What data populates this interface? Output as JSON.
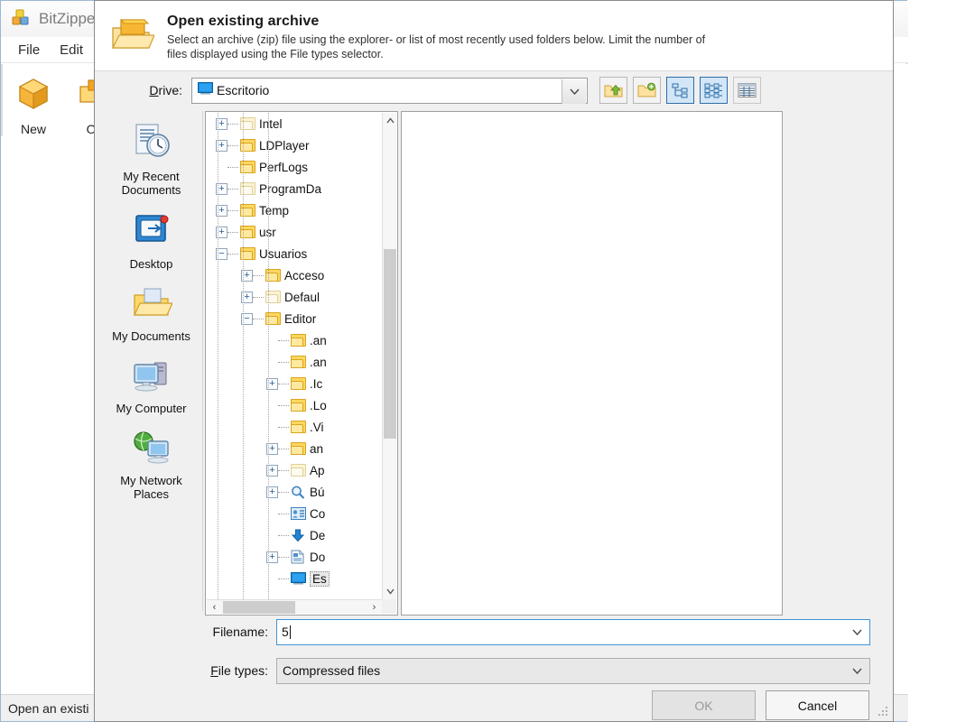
{
  "background_window": {
    "title": "BitZipper",
    "menus": [
      "File",
      "Edit"
    ],
    "toolbar_buttons": [
      {
        "label": "New",
        "icon": "new-archive-icon"
      },
      {
        "label": "Op",
        "icon": "open-archive-icon"
      }
    ],
    "window_controls": {
      "restore": "❐",
      "close": "✕"
    },
    "status_text": "Open an existi"
  },
  "dialog": {
    "icon": "open-folder-archive-icon",
    "title": "Open existing archive",
    "subtitle": "Select an archive (zip) file using the explorer- or list of most recently used folders below. Limit the number of files displayed using the File types selector.",
    "drive": {
      "label": "Drive:",
      "label_accel": "D",
      "value": "Escritorio",
      "icon": "monitor-icon",
      "arrow": "⌄"
    },
    "toolbar": [
      {
        "name": "up-one-level-button",
        "icon": "folder-up-arrow-icon",
        "selected": false
      },
      {
        "name": "create-new-folder-button",
        "icon": "folder-new-icon",
        "selected": false
      },
      {
        "name": "tree-view-button",
        "icon": "tree-view-icon",
        "selected": true
      },
      {
        "name": "list-view-button",
        "icon": "list-view-icon",
        "selected": true
      },
      {
        "name": "details-view-button",
        "icon": "details-view-icon",
        "selected": false
      }
    ],
    "places": [
      {
        "label": "My Recent Documents",
        "icon": "recent-documents-icon"
      },
      {
        "label": "Desktop",
        "icon": "desktop-icon"
      },
      {
        "label": "My Documents",
        "icon": "my-documents-icon"
      },
      {
        "label": "My Computer",
        "icon": "my-computer-icon"
      },
      {
        "label": "My Network Places",
        "icon": "network-places-icon"
      }
    ],
    "tree": [
      {
        "label": "Intel",
        "indent": 1,
        "expander": "+",
        "icon": "folder-pale-icon",
        "selected": false
      },
      {
        "label": "LDPlayer",
        "indent": 1,
        "expander": "+",
        "icon": "folder-icon",
        "selected": false
      },
      {
        "label": "PerfLogs",
        "indent": 1,
        "expander": "",
        "icon": "folder-icon",
        "selected": false
      },
      {
        "label": "ProgramDа",
        "indent": 1,
        "expander": "+",
        "icon": "folder-pale-icon",
        "selected": false
      },
      {
        "label": "Temp",
        "indent": 1,
        "expander": "+",
        "icon": "folder-icon",
        "selected": false
      },
      {
        "label": "usr",
        "indent": 1,
        "expander": "+",
        "icon": "folder-icon",
        "selected": false
      },
      {
        "label": "Usuarios",
        "indent": 1,
        "expander": "−",
        "icon": "folder-icon",
        "selected": false
      },
      {
        "label": "Accesо",
        "indent": 2,
        "expander": "+",
        "icon": "folder-icon",
        "selected": false
      },
      {
        "label": "Defaul",
        "indent": 2,
        "expander": "+",
        "icon": "folder-pale-icon",
        "selected": false
      },
      {
        "label": "Editor",
        "indent": 2,
        "expander": "−",
        "icon": "folder-icon",
        "selected": false
      },
      {
        "label": ".an",
        "indent": 3,
        "expander": "",
        "icon": "folder-icon",
        "selected": false
      },
      {
        "label": ".an",
        "indent": 3,
        "expander": "",
        "icon": "folder-icon",
        "selected": false
      },
      {
        "label": ".Ic",
        "indent": 3,
        "expander": "+",
        "icon": "folder-icon",
        "selected": false
      },
      {
        "label": ".Lo",
        "indent": 3,
        "expander": "",
        "icon": "folder-icon",
        "selected": false
      },
      {
        "label": ".Vi",
        "indent": 3,
        "expander": "",
        "icon": "folder-icon",
        "selected": false
      },
      {
        "label": "an",
        "indent": 3,
        "expander": "+",
        "icon": "folder-icon",
        "selected": false
      },
      {
        "label": "Ap",
        "indent": 3,
        "expander": "+",
        "icon": "folder-pale-icon",
        "selected": false
      },
      {
        "label": "Bú",
        "indent": 3,
        "expander": "+",
        "icon": "search-icon",
        "selected": false
      },
      {
        "label": "Co",
        "indent": 3,
        "expander": "",
        "icon": "contacts-icon",
        "selected": false
      },
      {
        "label": "De",
        "indent": 3,
        "expander": "",
        "icon": "downloads-icon",
        "selected": false
      },
      {
        "label": "Do",
        "indent": 3,
        "expander": "+",
        "icon": "document-icon",
        "selected": false
      },
      {
        "label": "Es",
        "indent": 3,
        "expander": "",
        "icon": "monitor-icon",
        "selected": true
      }
    ],
    "scrollbars": {
      "vertical": {
        "up": "⌃",
        "down": "⌄"
      },
      "horizontal": {
        "left": "‹",
        "right": "›"
      }
    },
    "filename": {
      "label": "Filename:",
      "label_accel": "",
      "value": "5",
      "placeholder": "",
      "arrow": "⌄"
    },
    "filetypes": {
      "label": "File types:",
      "label_accel": "F",
      "value": "Compressed files",
      "arrow": "⌄"
    },
    "buttons": [
      {
        "label": "OK",
        "name": "ok-button",
        "enabled": false
      },
      {
        "label": "Cancel",
        "name": "cancel-button",
        "enabled": true
      }
    ]
  }
}
